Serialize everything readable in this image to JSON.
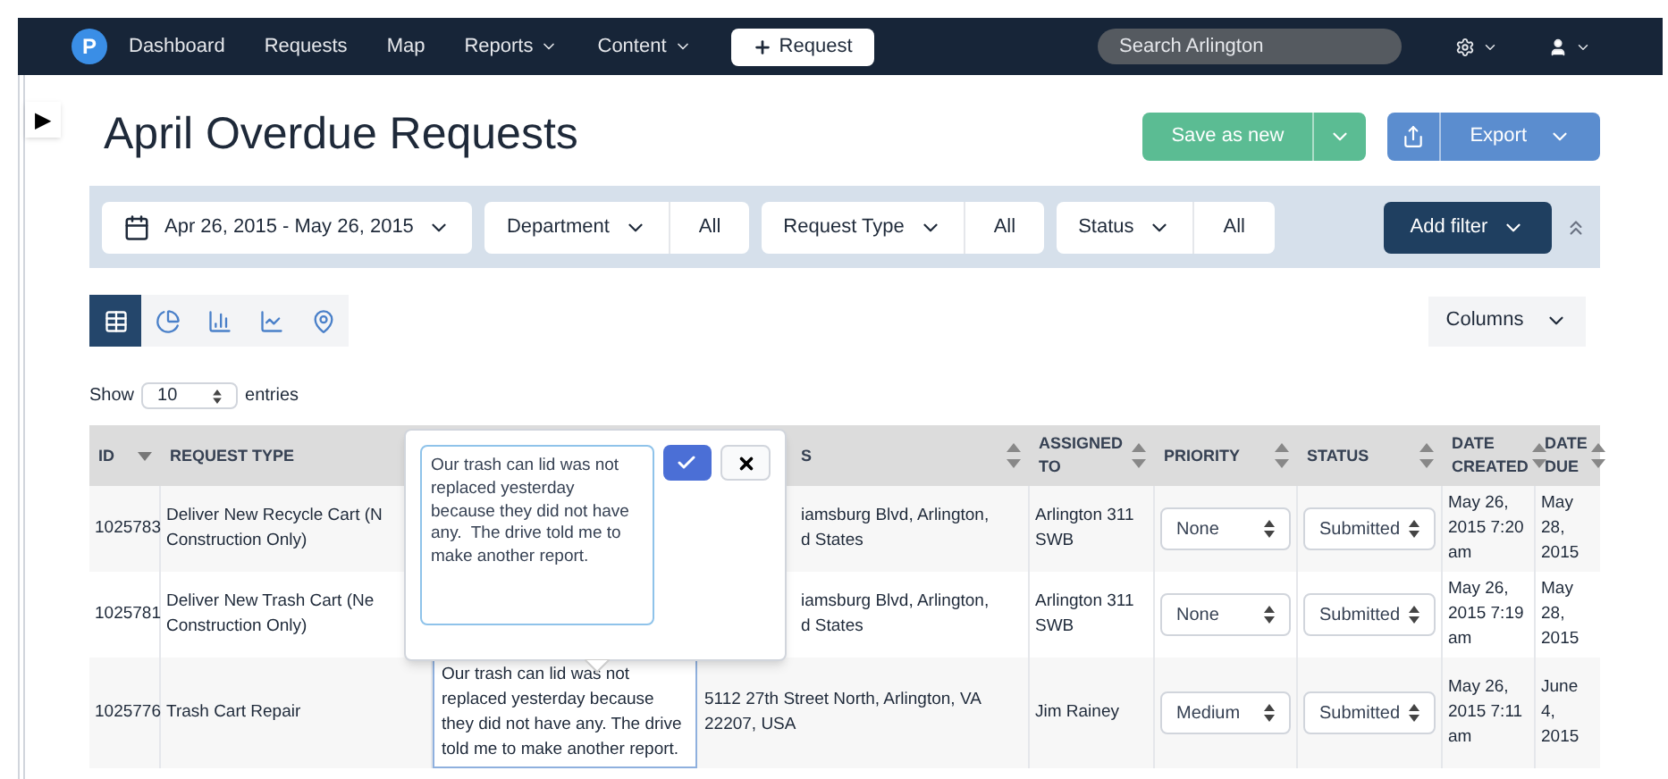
{
  "nav": {
    "logo": "P",
    "items": [
      {
        "label": "Dashboard",
        "dropdown": false
      },
      {
        "label": "Requests",
        "dropdown": false
      },
      {
        "label": "Map",
        "dropdown": false
      },
      {
        "label": "Reports",
        "dropdown": true
      },
      {
        "label": "Content",
        "dropdown": true
      }
    ],
    "new_button": "Request",
    "search": {
      "placeholder": "Search Arlington"
    }
  },
  "sidebar_toggle": "▶",
  "title": "April Overdue Requests",
  "actions": {
    "save": "Save as new",
    "export": "Export"
  },
  "filters": {
    "date_range": "Apr 26, 2015 - May 26, 2015",
    "items": [
      {
        "label": "Department",
        "value": "All"
      },
      {
        "label": "Request Type",
        "value": "All"
      },
      {
        "label": "Status",
        "value": "All"
      }
    ],
    "add": "Add filter"
  },
  "views": [
    {
      "kind": "table",
      "selected": true
    },
    {
      "kind": "pie",
      "selected": false
    },
    {
      "kind": "bar",
      "selected": false
    },
    {
      "kind": "line",
      "selected": false
    },
    {
      "kind": "map",
      "selected": false
    }
  ],
  "columns_button": "Columns",
  "show": {
    "before": "Show",
    "value": "10",
    "after": "entries"
  },
  "table": {
    "columns": [
      {
        "label": "ID",
        "kind": "sorted"
      },
      {
        "label": "REQUEST TYPE",
        "kind": "plain"
      },
      {
        "kind": "plain"
      },
      {
        "label": "S",
        "kind": "sortable",
        "covered": true
      },
      {
        "label": "ASSIGNED TO",
        "kind": "sortable"
      },
      {
        "label": "PRIORITY",
        "kind": "sortable"
      },
      {
        "label": "STATUS",
        "kind": "sortable"
      },
      {
        "label": "DATE CREATED",
        "kind": "sortable"
      },
      {
        "label": "DATE DUE",
        "kind": "sortable"
      }
    ],
    "rows": [
      {
        "id": "1025783",
        "type": [
          "Deliver New Recycle Cart (N",
          "Construction Only)"
        ],
        "editing": false,
        "covered": true,
        "address": [
          "iamsburg Blvd, Arlington,",
          "d States"
        ],
        "assigned": "Arlington 311 SWB",
        "priority": "None",
        "status": "Submitted",
        "created": "May 26, 2015 7:20 am",
        "due": "May 28, 2015"
      },
      {
        "id": "1025781",
        "type": [
          "Deliver New Trash Cart (Ne",
          "Construction Only)"
        ],
        "editing": false,
        "covered": true,
        "address": [
          "iamsburg Blvd, Arlington,",
          "d States"
        ],
        "assigned": "Arlington 311 SWB",
        "priority": "None",
        "status": "Submitted",
        "created": "May 26, 2015 7:19 am",
        "due": "May 28, 2015"
      },
      {
        "id": "1025776",
        "type": [
          "Trash Cart Repair"
        ],
        "description": "Our trash can lid was not replaced yesterday because they did not have any.  The drive told me to make another report.",
        "editing": true,
        "covered": false,
        "address": [
          "5112 27th Street North, Arlington, VA 22207, USA"
        ],
        "assigned": "Jim Rainey",
        "priority": "Medium",
        "status": "Submitted",
        "created": "May 26, 2015 7:11 am",
        "due": "June 4, 2015"
      }
    ]
  },
  "popover": {
    "value": "Our trash can lid was not replaced yesterday because they did not have any.  The drive told me to make another report."
  }
}
